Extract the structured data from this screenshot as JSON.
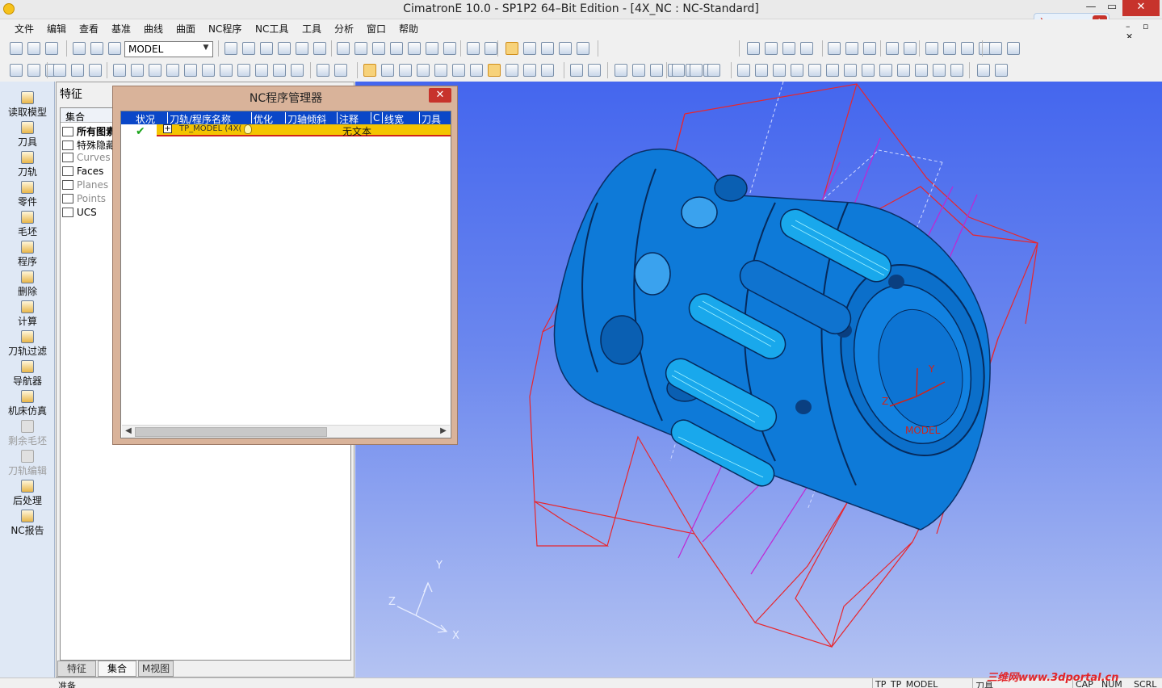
{
  "window": {
    "title": "CimatronE 10.0 - SP1P2 64–Bit Edition - [4X_NC : NC-Standard]",
    "minimize_icon": "minimize-icon",
    "maximize_icon": "restore-icon",
    "close_icon": "close-icon",
    "mdi_controls": "– ▫ ✕"
  },
  "xunlei": {
    "label": "迅雷7",
    "badge": "ϟ"
  },
  "menu": [
    "文件",
    "编辑",
    "查看",
    "基准",
    "曲线",
    "曲面",
    "NC程序",
    "NC工具",
    "工具",
    "分析",
    "窗口",
    "帮助"
  ],
  "toolbar": {
    "model_select_value": "MODEL"
  },
  "left_toolbar": {
    "items": [
      {
        "label": "读取模型",
        "icon": "load-model-icon",
        "enabled": true
      },
      {
        "label": "刀具",
        "icon": "tool-icon",
        "enabled": true
      },
      {
        "label": "刀轨",
        "icon": "toolpath-icon",
        "enabled": true
      },
      {
        "label": "零件",
        "icon": "part-icon",
        "enabled": true
      },
      {
        "label": "毛坯",
        "icon": "stock-icon",
        "enabled": true
      },
      {
        "label": "程序",
        "icon": "procedure-icon",
        "enabled": true
      },
      {
        "label": "删除",
        "icon": "delete-icon",
        "enabled": true
      },
      {
        "label": "计算",
        "icon": "compute-icon",
        "enabled": true
      },
      {
        "label": "刀轨过滤",
        "icon": "filter-icon",
        "enabled": true
      },
      {
        "label": "导航器",
        "icon": "navigator-icon",
        "enabled": true
      },
      {
        "label": "机床仿真",
        "icon": "machine-sim-icon",
        "enabled": true
      },
      {
        "label": "剩余毛坯",
        "icon": "remaining-stock-icon",
        "enabled": false
      },
      {
        "label": "刀轨编辑",
        "icon": "toolpath-edit-icon",
        "enabled": false
      },
      {
        "label": "后处理",
        "icon": "post-process-icon",
        "enabled": true
      },
      {
        "label": "NC报告",
        "icon": "nc-report-icon",
        "enabled": true
      }
    ]
  },
  "feature_panel": {
    "title": "特征",
    "tree_header": "集合",
    "rows": [
      {
        "label": "所有图素",
        "style": "bold"
      },
      {
        "label": "特殊隐藏",
        "style": "normal"
      },
      {
        "label": "Curves",
        "style": "grey"
      },
      {
        "label": "Faces",
        "style": "normal"
      },
      {
        "label": "Planes",
        "style": "grey"
      },
      {
        "label": "Points",
        "style": "grey"
      },
      {
        "label": "UCS",
        "style": "normal"
      }
    ],
    "tabs": [
      "特征",
      "集合",
      "M视图"
    ],
    "active_tab": "集合"
  },
  "nc_dialog": {
    "title": "NC程序管理器",
    "columns": [
      "状况",
      "刀轨/程序名称",
      "优化",
      "刀轴倾斜",
      "注释",
      "C",
      "线宽",
      "刀具"
    ],
    "row": {
      "status": "✔",
      "expand": "+",
      "name": "TP_MODEL (4X(",
      "note": "无文本"
    }
  },
  "viewport": {
    "axis_labels": {
      "x": "X",
      "y": "Y",
      "z": "Z"
    },
    "model_labels": {
      "y": "Y",
      "z": "Z",
      "name": "MODEL"
    }
  },
  "statusbar": {
    "left": "准备",
    "toolpath": "TP_TP_MODEL",
    "tool": "刀具",
    "cap": "CAP",
    "num": "NUM",
    "scrl": "SCRL"
  },
  "watermark": "三维网www.3dportal.cn"
}
